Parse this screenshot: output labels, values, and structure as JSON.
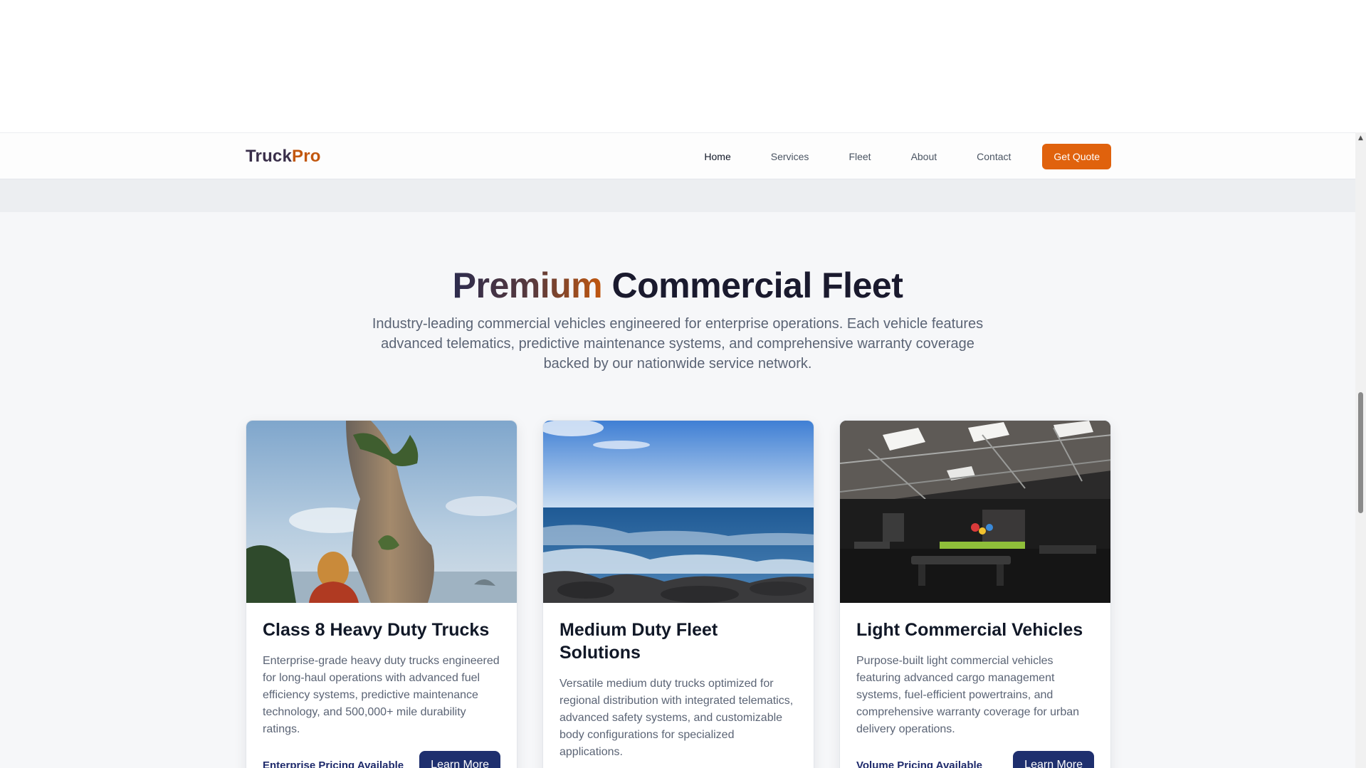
{
  "navbar": {
    "brand_part1": "Truck",
    "brand_part2": "Pro",
    "links": [
      "Home",
      "Services",
      "Fleet",
      "About",
      "Contact"
    ],
    "active_link": "Home",
    "cta_label": "Get Quote"
  },
  "hero": {
    "heading_highlight": "Premium",
    "heading_rest": " Commercial Fleet",
    "lead": "Industry-leading commercial vehicles engineered for enterprise operations. Each vehicle features advanced telematics, predictive maintenance systems, and comprehensive warranty coverage backed by our nationwide service network."
  },
  "cards": [
    {
      "image": "limestone-sea-stack-photo",
      "title": "Class 8 Heavy Duty Trucks",
      "text": "Enterprise-grade heavy duty trucks engineered for long-haul operations with advanced fuel efficiency systems, predictive maintenance technology, and 500,000+ mile durability ratings.",
      "pricing": "Enterprise Pricing Available",
      "button": "Learn More"
    },
    {
      "image": "ocean-rocky-shore-photo",
      "title": "Medium Duty Fleet Solutions",
      "text": "Versatile medium duty trucks optimized for regional distribution with integrated telematics, advanced safety systems, and customizable body configurations for specialized applications.",
      "pricing": "",
      "button": ""
    },
    {
      "image": "industrial-gym-interior-photo",
      "title": "Light Commercial Vehicles",
      "text": "Purpose-built light commercial vehicles featuring advanced cargo management systems, fuel-efficient powertrains, and comprehensive warranty coverage for urban delivery operations.",
      "pricing": "Volume Pricing Available",
      "button": "Learn More"
    }
  ],
  "colors": {
    "accent": "#e0620d",
    "brand_dark": "#3a2f4a",
    "button_navy": "#1e2f6e",
    "pricing_text": "#1e2a6b"
  }
}
